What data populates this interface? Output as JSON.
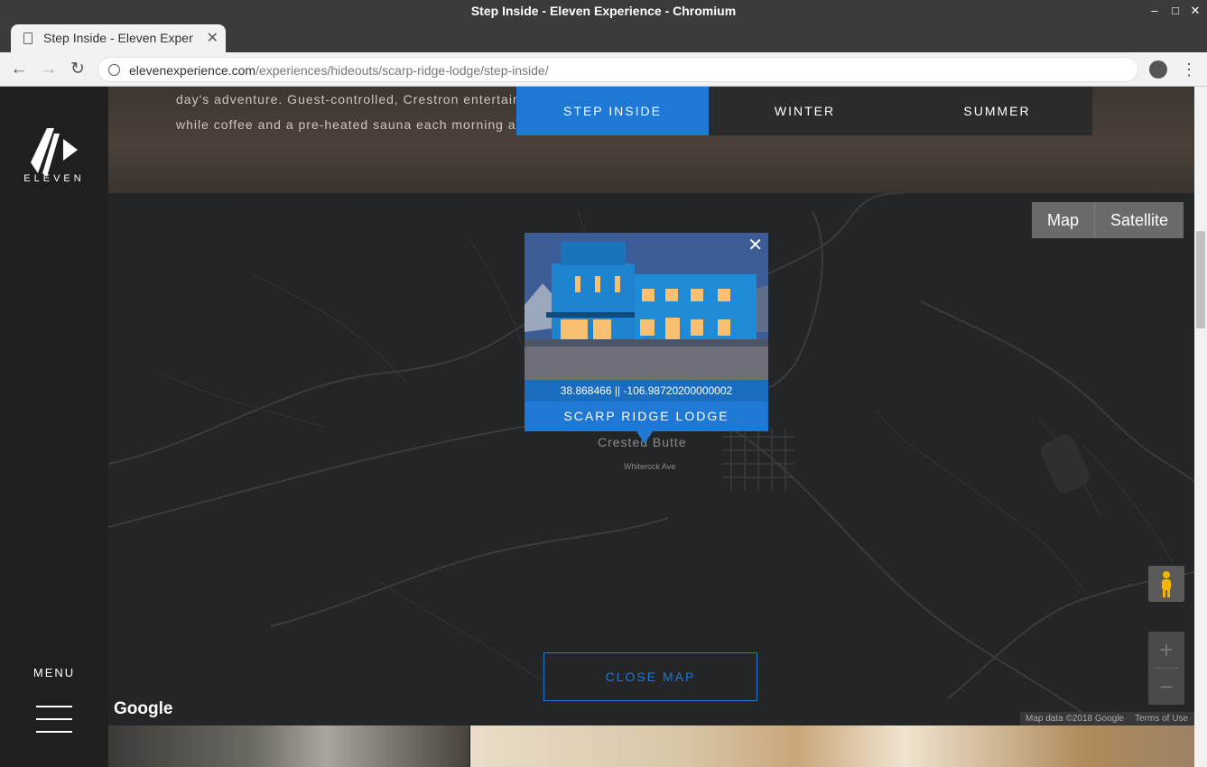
{
  "window": {
    "title": "Step Inside - Eleven Experience - Chromium"
  },
  "browser": {
    "tab_title": "Step Inside - Eleven Exper",
    "url_domain": "elevenexperience.com",
    "url_path": "/experiences/hideouts/scarp-ridge-lodge/step-inside/"
  },
  "sidebar": {
    "logo_text": "ELEVEN",
    "menu_label": "MENU"
  },
  "hero": {
    "text_line1": "day's adventure. Guest-controlled, Crestron entertainment systems accommodate music preferences,",
    "text_line2": "while coffee and a pre-heated sauna each morning are just two of the lodge's many details."
  },
  "tabs": [
    {
      "label": "STEP INSIDE",
      "active": true
    },
    {
      "label": "WINTER",
      "active": false
    },
    {
      "label": "SUMMER",
      "active": false
    }
  ],
  "map": {
    "toggle": [
      "Map",
      "Satellite"
    ],
    "popup": {
      "coords": "38.868466 || -106.98720200000002",
      "title": "SCARP RIDGE LODGE"
    },
    "town_label": "Crested Butte",
    "street_label": "Whiterock Ave",
    "close_button": "CLOSE MAP",
    "google": "Google",
    "attribution": {
      "data": "Map data ©2018 Google",
      "terms": "Terms of Use"
    },
    "zoom_in": "+",
    "zoom_out": "−"
  },
  "colors": {
    "accent": "#1e78d4",
    "map_bg": "#242526",
    "sidebar_bg": "#1f1f1f"
  }
}
